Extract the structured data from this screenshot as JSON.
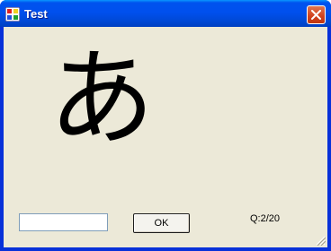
{
  "window": {
    "title": "Test",
    "app_icon": "windows-app-icon",
    "close_icon": "close-x-icon"
  },
  "main": {
    "kana": "あ",
    "answer_value": "",
    "ok_label": "OK",
    "progress_text": "Q:2/20"
  },
  "colors": {
    "titlebar": "#0054e3",
    "client_bg": "#ece9d8",
    "close_button": "#d0411d"
  }
}
